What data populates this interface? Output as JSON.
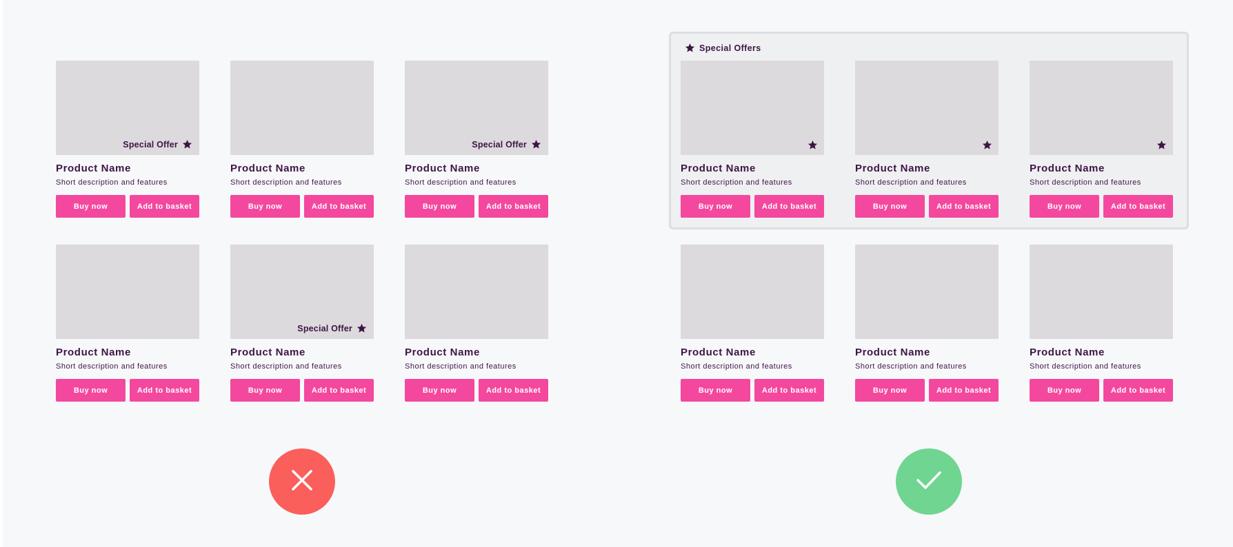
{
  "colors": {
    "background": "#f7f8fa",
    "thumbnail": "#dcdadd",
    "text": "#3e1445",
    "button": "#f4489e",
    "button_text": "#ffffff",
    "offers_box_bg": "#eff0f2",
    "offers_box_border": "#dddee1",
    "wrong": "#fa5f5c",
    "right": "#6fd591"
  },
  "bad_example": {
    "verdict_icon": "cross-icon",
    "products": [
      {
        "name": "Product Name",
        "description": "Short description and features",
        "buy_label": "Buy now",
        "basket_label": "Add to basket",
        "offer_label": "Special Offer",
        "icon": "star-icon"
      },
      {
        "name": "Product Name",
        "description": "Short description and features",
        "buy_label": "Buy now",
        "basket_label": "Add to basket"
      },
      {
        "name": "Product Name",
        "description": "Short description and features",
        "buy_label": "Buy now",
        "basket_label": "Add to basket",
        "offer_label": "Special Offer",
        "icon": "star-icon"
      },
      {
        "name": "Product Name",
        "description": "Short description and features",
        "buy_label": "Buy now",
        "basket_label": "Add to basket"
      },
      {
        "name": "Product Name",
        "description": "Short description and features",
        "buy_label": "Buy now",
        "basket_label": "Add to basket",
        "offer_label": "Special Offer",
        "icon": "star-icon"
      },
      {
        "name": "Product Name",
        "description": "Short description and features",
        "buy_label": "Buy now",
        "basket_label": "Add to basket"
      }
    ]
  },
  "good_example": {
    "verdict_icon": "check-icon",
    "offers_heading": "Special Offers",
    "offers_icon": "star-icon",
    "products": [
      {
        "name": "Product Name",
        "description": "Short description and features",
        "buy_label": "Buy now",
        "basket_label": "Add to basket",
        "icon": "star-icon"
      },
      {
        "name": "Product Name",
        "description": "Short description and features",
        "buy_label": "Buy now",
        "basket_label": "Add to basket",
        "icon": "star-icon"
      },
      {
        "name": "Product Name",
        "description": "Short description and features",
        "buy_label": "Buy now",
        "basket_label": "Add to basket",
        "icon": "star-icon"
      },
      {
        "name": "Product Name",
        "description": "Short description and features",
        "buy_label": "Buy now",
        "basket_label": "Add to basket"
      },
      {
        "name": "Product Name",
        "description": "Short description and features",
        "buy_label": "Buy now",
        "basket_label": "Add to basket"
      },
      {
        "name": "Product Name",
        "description": "Short description and features",
        "buy_label": "Buy now",
        "basket_label": "Add to basket"
      }
    ]
  }
}
